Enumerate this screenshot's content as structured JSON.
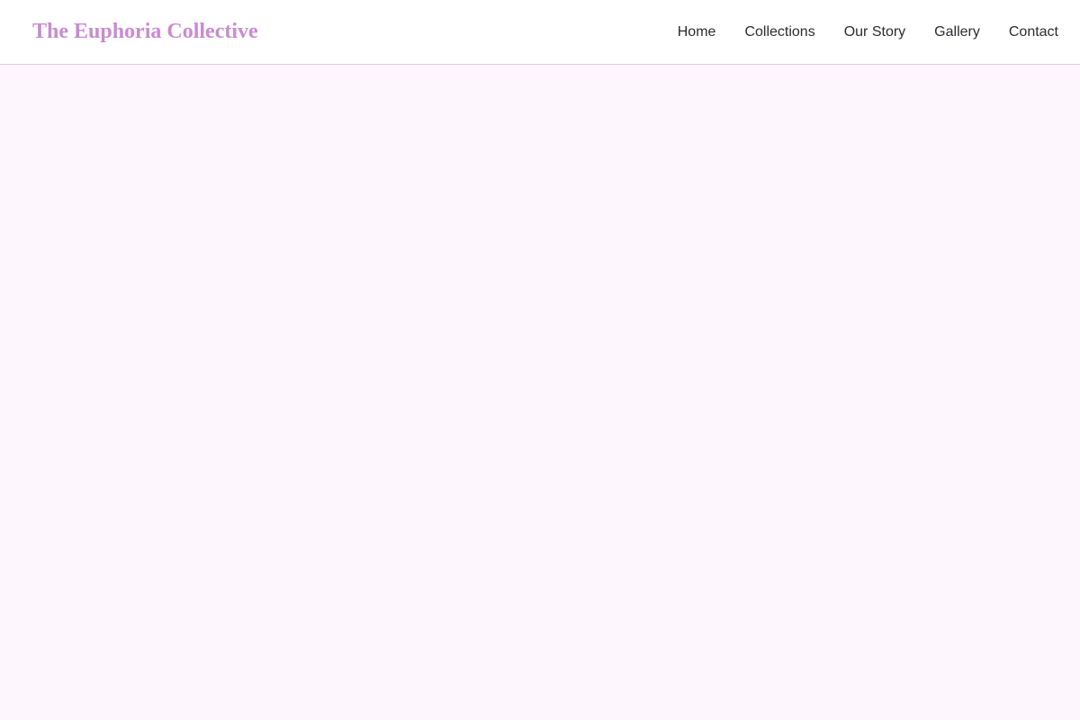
{
  "header": {
    "brand": "The Euphoria Collective",
    "nav": [
      {
        "label": "Home"
      },
      {
        "label": "Collections"
      },
      {
        "label": "Our Story"
      },
      {
        "label": "Gallery"
      },
      {
        "label": "Contact"
      }
    ]
  },
  "colors": {
    "brand": "#c98bd0",
    "header_background": "#ffffff",
    "page_background": "#fdf7fd",
    "nav_text": "#2e2a33",
    "divider": "#d9c9d9"
  }
}
